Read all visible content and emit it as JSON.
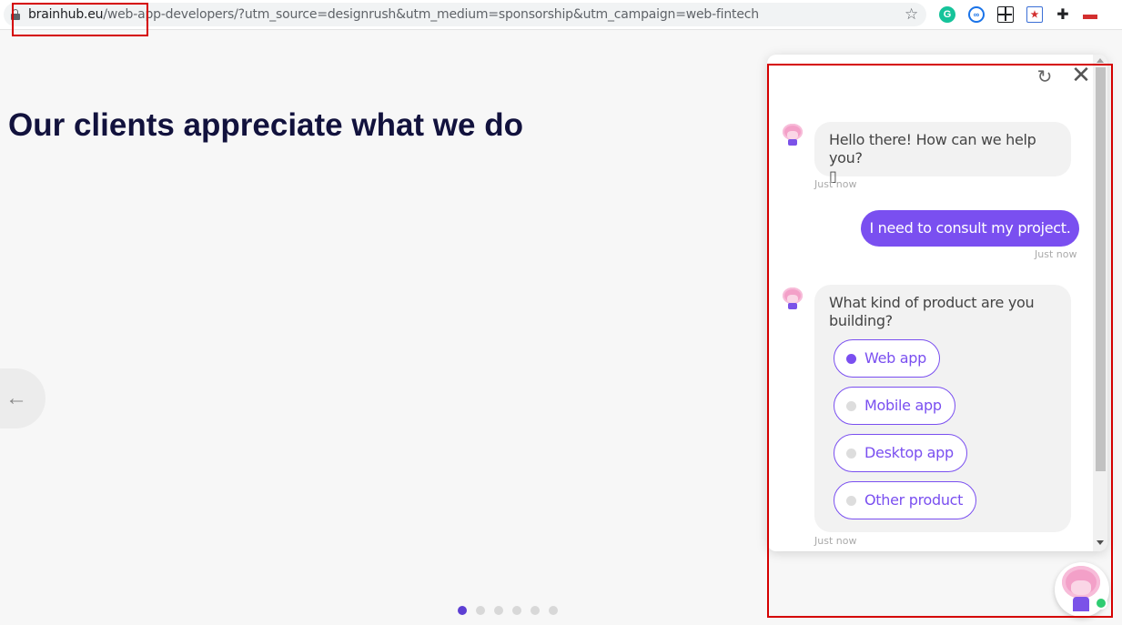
{
  "browser": {
    "url_domain": "brainhub.eu",
    "url_path": "/web-app-developers/?utm_source=designrush&utm_medium=sponsorship&utm_campaign=web-fintech",
    "icons": [
      "lock-icon",
      "star-icon",
      "grammarly-icon",
      "infinity-extension-icon",
      "grid-extension-icon",
      "calendar-extension-icon",
      "puzzle-icon",
      "flag-icon"
    ]
  },
  "page": {
    "heading": "Our clients appreciate what we do",
    "prev_arrow": "←",
    "carousel_dot_count": 6,
    "carousel_active_dot": 1
  },
  "chat": {
    "refresh_icon": "↻",
    "close_icon": "✕",
    "messages": [
      {
        "from": "bot",
        "text": "Hello there! How can we help you?",
        "emoji": "▯",
        "time": "Just now"
      },
      {
        "from": "user",
        "text": "I need to consult my project.",
        "time": "Just now"
      },
      {
        "from": "bot",
        "text": "What kind of product are you building?",
        "time": "Just now"
      }
    ],
    "options": [
      {
        "label": "Web app",
        "selected": true
      },
      {
        "label": "Mobile app",
        "selected": false
      },
      {
        "label": "Desktop app",
        "selected": false
      },
      {
        "label": "Other product",
        "selected": false
      }
    ]
  },
  "colors": {
    "accent": "#7a4ff0",
    "heading": "#12123d",
    "online": "#2ecc71",
    "annotation": "#d50000"
  }
}
